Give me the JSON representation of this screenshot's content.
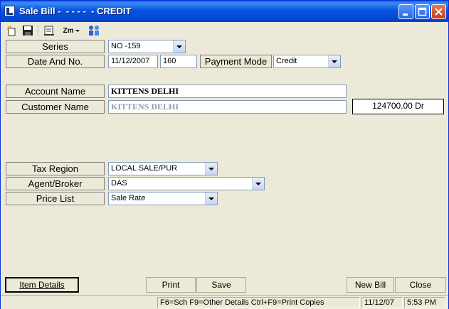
{
  "window": {
    "title": "Sale Bill -  - - - -  - CREDIT"
  },
  "toolbar": {
    "items": [
      {
        "name": "new-doc-icon"
      },
      {
        "name": "save-icon"
      },
      {
        "name": "export-icon"
      },
      {
        "name": "zoom-dropdown",
        "label": "Zm"
      },
      {
        "name": "users-icon"
      }
    ]
  },
  "form": {
    "series": {
      "label": "Series",
      "value": "NO  -159"
    },
    "date_no": {
      "label": "Date And No.",
      "date": "11/12/2007",
      "number": "160"
    },
    "payment_mode": {
      "label": "Payment Mode",
      "value": "Credit"
    },
    "account_name": {
      "label": "Account Name",
      "value": "KITTENS DELHI"
    },
    "customer_name": {
      "label": "Customer Name",
      "value": "KITTENS DELHI"
    },
    "balance": "124700.00 Dr",
    "tax_region": {
      "label": "Tax Region",
      "value": "LOCAL SALE/PUR"
    },
    "agent_broker": {
      "label": "Agent/Broker",
      "value": "DAS"
    },
    "price_list": {
      "label": "Price List",
      "value": "Sale Rate"
    }
  },
  "buttons": {
    "item_details": "Item Details",
    "print": "Print",
    "save": "Save",
    "new_bill": "New Bill",
    "close": "Close"
  },
  "status": {
    "hints": "F6=Sch F9=Other Details Ctrl+F9=Print Copies",
    "date": "11/12/07",
    "time": "5:53 PM"
  },
  "colors": {
    "titlebar": "#0554e0",
    "panel": "#ece9d8"
  }
}
